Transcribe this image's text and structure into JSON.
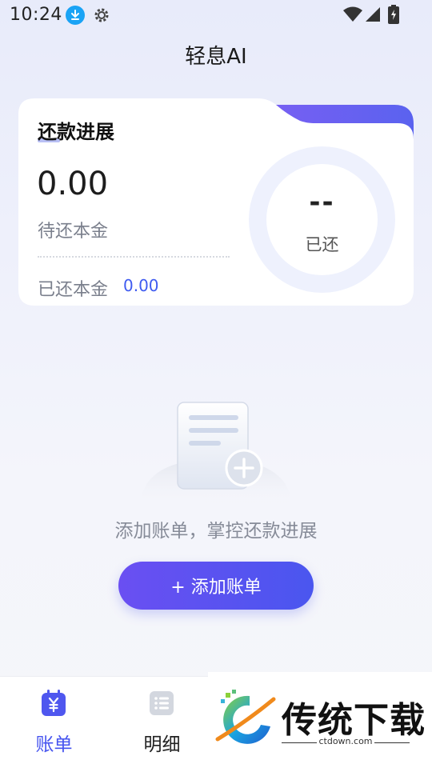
{
  "status_bar": {
    "time": "10:24"
  },
  "app": {
    "title": "轻息AI"
  },
  "progress_card": {
    "title": "还款进展",
    "amount": "0.00",
    "amount_label": "待还本金",
    "paid_label": "已还本金",
    "paid_value": "0.00",
    "ring_value": "--",
    "ring_label": "已还"
  },
  "empty_state": {
    "message": "添加账单，掌控还款进展",
    "button_label": "+ 添加账单"
  },
  "tab_bar": {
    "items": [
      {
        "label": "账单",
        "icon": "bill-icon",
        "active": true
      },
      {
        "label": "明细",
        "icon": "list-icon",
        "active": false
      }
    ]
  },
  "watermark": {
    "text": "传统下载",
    "url": "ctdown.com"
  },
  "colors": {
    "accent": "#4654ef",
    "paid_value": "#3f5bf0",
    "card_tab": "#6a5cf0"
  }
}
